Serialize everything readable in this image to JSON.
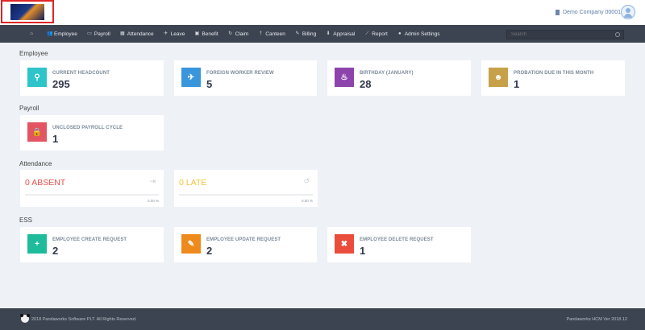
{
  "header": {
    "company": "Demo Company 00001"
  },
  "nav": {
    "items": [
      {
        "label": "Employee",
        "icon": "users-icon"
      },
      {
        "label": "Payroll",
        "icon": "money-icon"
      },
      {
        "label": "Attendance",
        "icon": "calendar-icon"
      },
      {
        "label": "Leave",
        "icon": "plane-icon"
      },
      {
        "label": "Benefit",
        "icon": "gift-icon"
      },
      {
        "label": "Claim",
        "icon": "refresh-icon"
      },
      {
        "label": "Canteen",
        "icon": "utensils-icon"
      },
      {
        "label": "Billing",
        "icon": "edit-icon"
      },
      {
        "label": "Appraisal",
        "icon": "thumb-icon"
      },
      {
        "label": "Report",
        "icon": "chart-icon"
      },
      {
        "label": "Admin Settings",
        "icon": "user-cog-icon"
      }
    ],
    "search_placeholder": "Search"
  },
  "sections": {
    "employee": "Employee",
    "payroll": "Payroll",
    "attendance": "Attendance",
    "ess": "ESS"
  },
  "employee_cards": [
    {
      "label": "CURRENT HEADCOUNT",
      "value": "295",
      "color": "#2ec4c9",
      "icon": "person-icon"
    },
    {
      "label": "FOREIGN WORKER REVIEW",
      "value": "5",
      "color": "#3a96dc",
      "icon": "plane-icon"
    },
    {
      "label": "BIRTHDAY (JANUARY)",
      "value": "28",
      "color": "#8e44ad",
      "icon": "cake-icon"
    },
    {
      "label": "PROBATION DUE IN THIS MONTH",
      "value": "1",
      "color": "#c7a14a",
      "icon": "group-icon"
    }
  ],
  "payroll_cards": [
    {
      "label": "UNCLOSED PAYROLL CYCLE",
      "value": "1",
      "color": "#e35560",
      "icon": "lock-icon"
    }
  ],
  "attendance": {
    "absent": {
      "count": "0",
      "label": "ABSENT",
      "pct": "0.00 %",
      "color": "#e8504c"
    },
    "late": {
      "count": "0",
      "label": "LATE",
      "pct": "0.00 %",
      "color": "#f4c23a"
    }
  },
  "ess_cards": [
    {
      "label": "EMPLOYEE CREATE REQUEST",
      "value": "2",
      "color": "#1fbc9c",
      "icon": "plus-icon"
    },
    {
      "label": "EMPLOYEE UPDATE REQUEST",
      "value": "2",
      "color": "#ee8a1c",
      "icon": "pencil-icon"
    },
    {
      "label": "EMPLOYEE DELETE REQUEST",
      "value": "1",
      "color": "#ea4d3c",
      "icon": "times-icon"
    }
  ],
  "footer": {
    "copyright": "2018 Pandaworks Software PLT. All Rights Reserved.",
    "version": "Pandaworks HCM Ver 2018.12"
  }
}
